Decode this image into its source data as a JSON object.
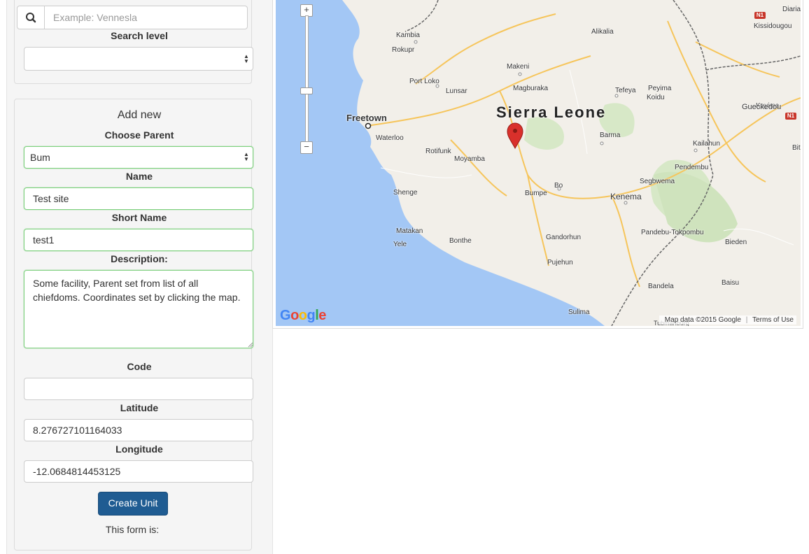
{
  "search": {
    "placeholder": "Example: Vennesla",
    "level_label": "Search level",
    "level_value": ""
  },
  "add_new": {
    "title": "Add new",
    "parent_label": "Choose Parent",
    "parent_value": "Bum",
    "name_label": "Name",
    "name_value": "Test site",
    "short_name_label": "Short Name",
    "short_name_value": "test1",
    "description_label": "Description:",
    "description_value": "Some facility, Parent set from list of all chiefdoms. Coordinates set by clicking the map.",
    "code_label": "Code",
    "code_value": "",
    "latitude_label": "Latitude",
    "latitude_value": "8.276727101164033",
    "longitude_label": "Longitude",
    "longitude_value": "-12.0684814453125",
    "create_button": "Create Unit",
    "form_status": "This form is:"
  },
  "map": {
    "country": "Sierra Leone",
    "cities": [
      "Freetown",
      "Kenema"
    ],
    "places": [
      "Diaria",
      "Kissidougou",
      "Kambia",
      "Alikalia",
      "Rokupr",
      "Makeni",
      "Port Loko",
      "Magburaka",
      "Lunsar",
      "Tefeya",
      "Peyima",
      "Koidu",
      "Kayima",
      "Gueckedou",
      "Waterloo",
      "Barma",
      "Rotifunk",
      "Moyamba",
      "Kailahun",
      "Bit",
      "Pendembu",
      "Shenge",
      "Bo",
      "Bumpe",
      "Segbwema",
      "Matakan",
      "Yele",
      "Bonthe",
      "Gandorhun",
      "Pandebu-Tokpombu",
      "Bieden",
      "Pujehun",
      "Bandela",
      "Baisu",
      "Sulima",
      "Tubmanburg"
    ],
    "road_shields": [
      "N1",
      "N1"
    ],
    "zoom_in": "+",
    "zoom_out": "−",
    "logo": "Google",
    "attribution": "Map data ©2015 Google",
    "terms": "Terms of Use",
    "water_color": "#a3c7f5",
    "land_color": "#f2efe9",
    "green_color": "#d7e8c7",
    "road_color": "#f6c55b",
    "marker_color": "#d9302b"
  }
}
